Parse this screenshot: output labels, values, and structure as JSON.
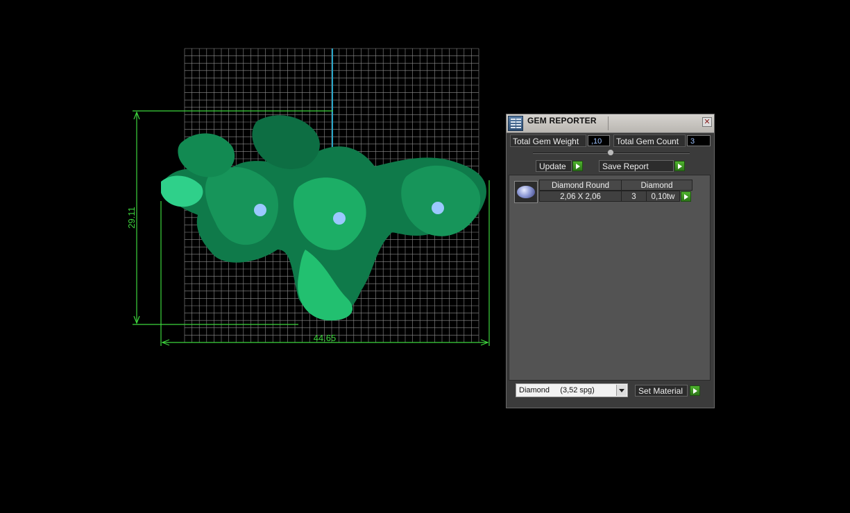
{
  "viewport": {
    "dimension_height": "29.11",
    "dimension_width": "44.65",
    "colors": {
      "grid": "#9a9a9a",
      "dimension": "#3ed63e",
      "axis": "#2aa6c8",
      "model": "#18a868"
    }
  },
  "panel": {
    "title": "GEM REPORTER",
    "close_label": "✕",
    "total_gem_weight_label": "Total Gem Weight",
    "total_gem_weight_value": ",10",
    "total_gem_count_label": "Total Gem Count",
    "total_gem_count_value": "3",
    "update_label": "Update",
    "save_report_label": "Save Report",
    "gem_rows": [
      {
        "shape": "Diamond Round",
        "material": "Diamond",
        "size": "2,06 X 2,06",
        "count": "3",
        "weight": "0,10tw"
      }
    ],
    "material_select": "Diamond     (3,52 spg)",
    "set_material_label": "Set Material"
  }
}
